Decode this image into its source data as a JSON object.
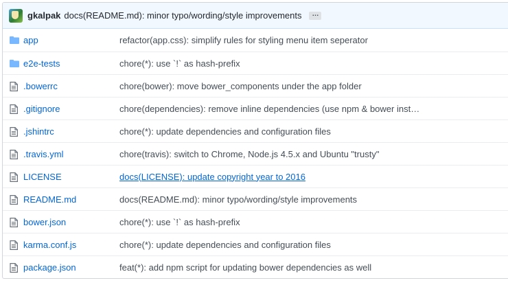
{
  "commit": {
    "author": "gkalpak",
    "message": "docs(README.md): minor typo/wording/style improvements",
    "more": "…"
  },
  "files": [
    {
      "type": "folder",
      "icon": "folder-icon",
      "name": "app",
      "message": "refactor(app.css): simplify rules for styling menu item seperator"
    },
    {
      "type": "folder",
      "icon": "folder-icon",
      "name": "e2e-tests",
      "message": "chore(*): use `!` as hash-prefix"
    },
    {
      "type": "file",
      "icon": "file-icon",
      "name": ".bowerrc",
      "message": "chore(bower): move bower_components under the app folder"
    },
    {
      "type": "file",
      "icon": "file-icon",
      "name": ".gitignore",
      "message": "chore(dependencies): remove inline dependencies (use npm & bower inst…"
    },
    {
      "type": "file",
      "icon": "file-icon",
      "name": ".jshintrc",
      "message": "chore(*): update dependencies and configuration files"
    },
    {
      "type": "file",
      "icon": "file-icon",
      "name": ".travis.yml",
      "message": "chore(travis): switch to Chrome, Node.js 4.5.x and Ubuntu \"trusty\""
    },
    {
      "type": "file",
      "icon": "file-icon",
      "name": "LICENSE",
      "message": "docs(LICENSE): update copyright year to 2016",
      "hover": true
    },
    {
      "type": "file",
      "icon": "file-icon",
      "name": "README.md",
      "message": "docs(README.md): minor typo/wording/style improvements"
    },
    {
      "type": "file",
      "icon": "file-icon",
      "name": "bower.json",
      "message": "chore(*): use `!` as hash-prefix"
    },
    {
      "type": "file",
      "icon": "file-icon",
      "name": "karma.conf.js",
      "message": "chore(*): update dependencies and configuration files"
    },
    {
      "type": "file",
      "icon": "file-icon",
      "name": "package.json",
      "message": "feat(*): add npm script for updating bower dependencies as well"
    }
  ],
  "colors": {
    "header_bg": "#f1f8ff",
    "link": "#0366d6",
    "folder": "#79b8ff",
    "border": "#eaecef"
  }
}
